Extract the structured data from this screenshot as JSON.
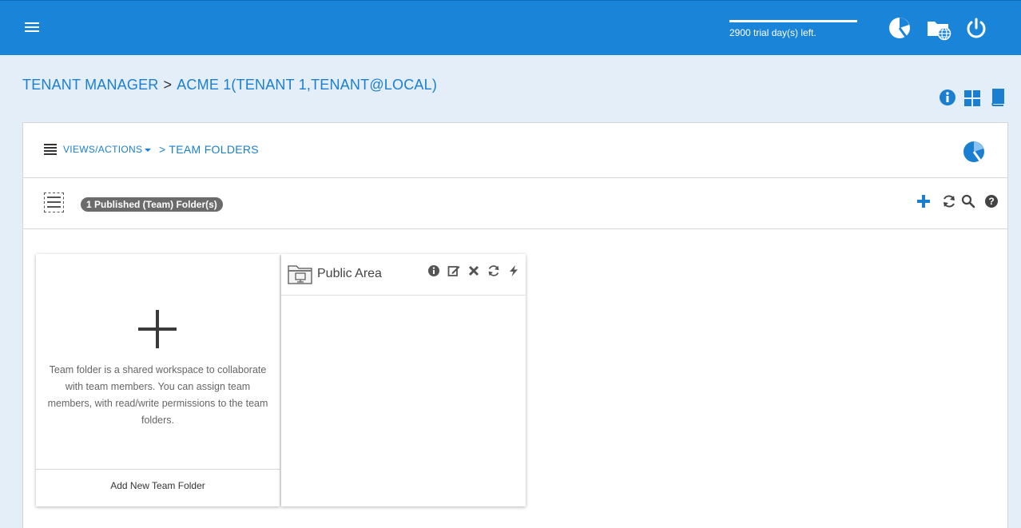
{
  "topbar": {
    "menu_icon": "hamburger-icon",
    "trial_text": "2900 trial day(s) left.",
    "trial_progress": 1.0,
    "icons": [
      "pie-chart-icon",
      "folder-globe-icon",
      "power-icon"
    ]
  },
  "header": {
    "crumb_root": "TENANT MANAGER",
    "crumb_sep": ">",
    "crumb_tenant": "ACME 1(TENANT 1,TENANT@LOCAL)",
    "icons": [
      "info-icon",
      "grid-icon",
      "book-icon"
    ]
  },
  "panel": {
    "views_label": "VIEWS/ACTIONS",
    "crumb": "> TEAM FOLDERS",
    "count_badge": "1 Published (Team) Folder(s)",
    "toolbar_icons": [
      "plus-icon",
      "refresh-icon",
      "search-icon",
      "help-icon"
    ]
  },
  "add_card": {
    "description": "Team folder is a shared workspace to collaborate with team members. You can assign team members, with read/write permissions to the team folders.",
    "footer": "Add New Team Folder"
  },
  "folder_card": {
    "name": "Public Area",
    "actions": [
      "info-icon",
      "edit-icon",
      "delete-icon",
      "sync-icon",
      "bolt-icon"
    ]
  },
  "colors": {
    "topbar": "#1a84d8",
    "accent": "#1a7fd1",
    "background": "#e4eef8",
    "badge": "#6b6b6b"
  }
}
